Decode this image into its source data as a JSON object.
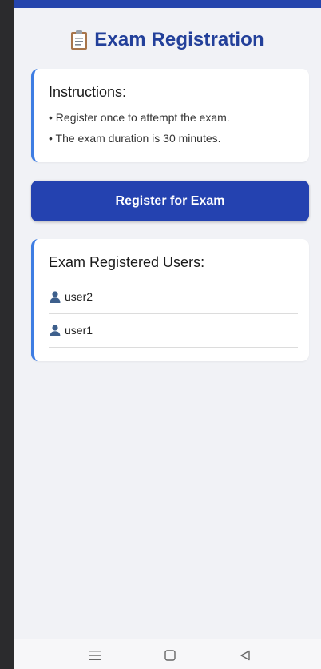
{
  "header": {
    "title": "Exam Registration",
    "title_icon": "clipboard-icon"
  },
  "instructions": {
    "title": "Instructions:",
    "items": [
      "• Register once to attempt the exam.",
      "• The exam duration is 30 minutes."
    ]
  },
  "register_button": {
    "label": "Register for Exam"
  },
  "registered_users": {
    "title": "Exam Registered Users:",
    "users": [
      {
        "icon": "user-icon",
        "name": "user2"
      },
      {
        "icon": "user-icon",
        "name": "user1"
      }
    ]
  },
  "nav_bar": {
    "icons": [
      "menu-icon",
      "home-icon",
      "back-icon"
    ]
  },
  "colors": {
    "accent": "#2442b0",
    "title": "#23409a",
    "card_border": "#3e7de3",
    "background": "#f1f2f6"
  }
}
